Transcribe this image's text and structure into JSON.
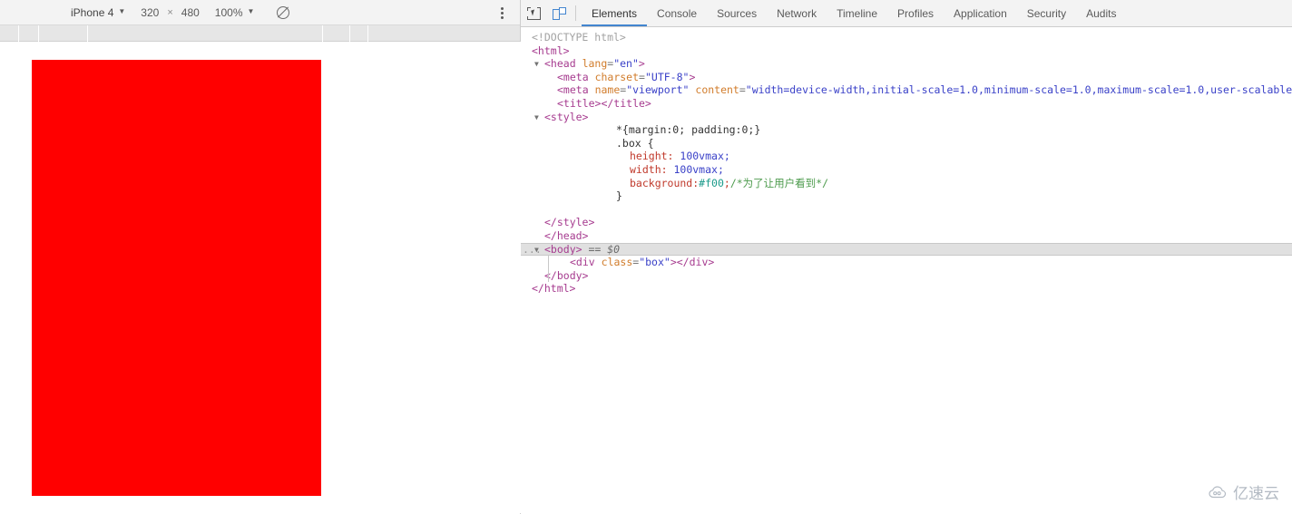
{
  "device_toolbar": {
    "device_name": "iPhone 4",
    "device_caret": "▼",
    "width": "320",
    "times": "×",
    "height": "480",
    "zoom": "100%",
    "zoom_caret": "▼",
    "rotate_icon": "rotate-disabled-icon",
    "menu_icon": "kebab-menu-icon"
  },
  "devtools": {
    "inspect_icon": "inspect-element-icon",
    "device_toggle_icon": "toggle-device-toolbar-icon",
    "tabs": [
      {
        "label": "Elements",
        "active": true
      },
      {
        "label": "Console",
        "active": false
      },
      {
        "label": "Sources",
        "active": false
      },
      {
        "label": "Network",
        "active": false
      },
      {
        "label": "Timeline",
        "active": false
      },
      {
        "label": "Profiles",
        "active": false
      },
      {
        "label": "Application",
        "active": false
      },
      {
        "label": "Security",
        "active": false
      },
      {
        "label": "Audits",
        "active": false
      }
    ]
  },
  "code": {
    "doctype": "<!DOCTYPE html>",
    "html_open": "<html>",
    "head_open_tag": "<head",
    "head_attr_name": "lang",
    "head_attr_value": "\"en\"",
    "head_close_bracket": ">",
    "meta_charset": "<meta charset=\"UTF-8\">",
    "meta_viewport_tag": "<meta",
    "meta_viewport_attr1": "name",
    "meta_viewport_val1": "\"viewport\"",
    "meta_viewport_attr2": "content",
    "meta_viewport_val2": "\"width=device-width,initial-scale=1.0,minimum-scale=1.0,maximum-scale=1.0,user-scalable=no\"",
    "title_line": "<title></title>",
    "style_open": "<style>",
    "css_reset": "*{margin:0; padding:0;}",
    "css_box_open": ".box {",
    "css_height_prop": "height:",
    "css_height_val": "100vmax;",
    "css_width_prop": "width:",
    "css_width_val": "100vmax;",
    "css_bg_prop": "background:",
    "css_bg_val": "#f00",
    "css_bg_semi": ";",
    "css_comment": "/*为了让用户看到*/",
    "css_box_close": "}",
    "style_close": "</style>",
    "head_close": "</head>",
    "body_open": "<body>",
    "body_marker": "== $0",
    "div_open": "<div",
    "div_attr": "class",
    "div_val": "\"box\"",
    "div_rest": "></div>",
    "body_close": "</body>",
    "html_close": "</html>",
    "triangle": "▼",
    "ellipsis": "..."
  },
  "watermark": {
    "text": "亿速云",
    "icon": "cloud-logo-icon"
  },
  "colors": {
    "accent": "#4285cf",
    "page_box": "#ff0000",
    "toolbar_bg": "#f3f3f3",
    "ruler_bg": "#e6e6e6",
    "selected_row": "#e0e0e0"
  },
  "ruler_ticks": [
    20,
    42,
    96,
    960,
    1034,
    1108
  ]
}
